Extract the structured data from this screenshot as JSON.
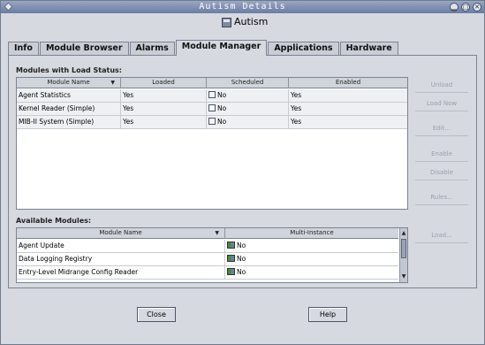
{
  "window": {
    "title": "Autism Details",
    "host_name": "Autism",
    "controls": [
      "minimize-icon",
      "maximize-icon",
      "close-icon"
    ]
  },
  "tabs": [
    {
      "label": "Info",
      "active": false
    },
    {
      "label": "Module Browser",
      "active": false
    },
    {
      "label": "Alarms",
      "active": false
    },
    {
      "label": "Module Manager",
      "active": true
    },
    {
      "label": "Applications",
      "active": false
    },
    {
      "label": "Hardware",
      "active": false
    }
  ],
  "loaded_modules": {
    "section_label": "Modules with Load Status:",
    "columns": [
      "Module Name",
      "Loaded",
      "Scheduled",
      "Enabled"
    ],
    "rows": [
      {
        "name": "Agent Statistics",
        "loaded": "Yes",
        "scheduled": "No",
        "enabled": "Yes"
      },
      {
        "name": "Kernel Reader (Simple)",
        "loaded": "Yes",
        "scheduled": "No",
        "enabled": "Yes"
      },
      {
        "name": "MIB-II System (Simple)",
        "loaded": "Yes",
        "scheduled": "No",
        "enabled": "Yes"
      }
    ]
  },
  "side_buttons": [
    "Unload",
    "Load Now",
    "Edit...",
    "Enable",
    "Disable",
    "Rules...",
    "Load..."
  ],
  "available_modules": {
    "section_label": "Available Modules:",
    "columns": [
      "Module Name",
      "Multi-Instance"
    ],
    "rows": [
      {
        "name": "Agent Update",
        "multi_instance": "No"
      },
      {
        "name": "Data Logging Registry",
        "multi_instance": "No"
      },
      {
        "name": "Entry-Level Midrange Config Reader",
        "multi_instance": "No"
      }
    ]
  },
  "buttons": {
    "close": "Close",
    "help": "Help"
  },
  "colors": {
    "titlebar": "#7d8db0",
    "background": "#d6d9df",
    "table_bg": "#ffffff"
  }
}
